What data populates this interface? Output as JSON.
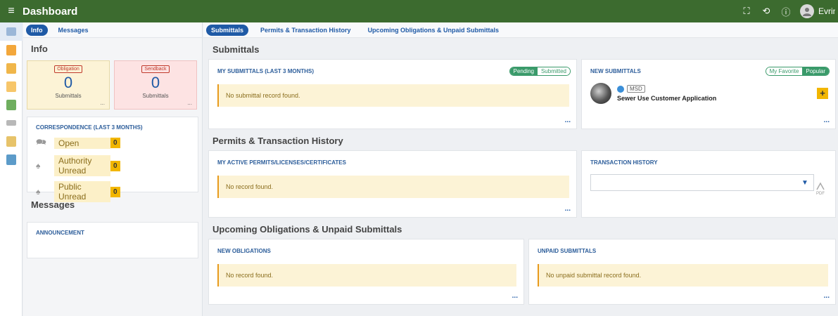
{
  "topbar": {
    "title": "Dashboard",
    "user_name": "Evrin"
  },
  "left": {
    "tabs": [
      "Info",
      "Messages"
    ],
    "info_heading": "Info",
    "cards": [
      {
        "badge": "Obligation",
        "count": "0",
        "label": "Submittals",
        "more": "..."
      },
      {
        "badge": "Sendback",
        "count": "0",
        "label": "Submittals",
        "more": "..."
      }
    ],
    "correspondence": {
      "title": "CORRESPONDENCE (LAST 3 MONTHS)",
      "items": [
        {
          "label": "Open",
          "count": "0"
        },
        {
          "label": "Authority Unread",
          "count": "0"
        },
        {
          "label": "Public Unread",
          "count": "0"
        }
      ]
    },
    "messages_heading": "Messages",
    "announcement_title": "ANNOUNCEMENT"
  },
  "main": {
    "tabs": [
      "Submittals",
      "Permits & Transaction History",
      "Upcoming Obligations & Unpaid Submittals"
    ],
    "submittals": {
      "heading": "Submittals",
      "my": {
        "title": "MY SUBMITTALS (LAST 3 MONTHS)",
        "toggle": [
          "Pending",
          "Submitted"
        ],
        "empty": "No submittal record found.",
        "more": "..."
      },
      "new": {
        "title": "NEW SUBMITTALS",
        "toggle": [
          "My Favorite",
          "Popular"
        ],
        "item_tag": "MSD",
        "item_title": "Sewer Use Customer Application",
        "add": "+",
        "more": "..."
      }
    },
    "permits": {
      "heading": "Permits & Transaction History",
      "active": {
        "title": "MY ACTIVE PERMITS/LICENSES/CERTIFICATES",
        "empty": "No record found.",
        "more": "..."
      },
      "history": {
        "title": "TRANSACTION HISTORY",
        "pdf": "PDF"
      }
    },
    "upcoming": {
      "heading": "Upcoming Obligations & Unpaid Submittals",
      "obligations": {
        "title": "NEW OBLIGATIONS",
        "empty": "No record found.",
        "more": "..."
      },
      "unpaid": {
        "title": "UNPAID SUBMITTALS",
        "empty": "No unpaid submittal record found.",
        "more": "..."
      }
    }
  },
  "colors": {
    "topbar": "#3c6b2f",
    "link": "#1f5aa6",
    "accent_yellow": "#f2b600",
    "toggle_green": "#3a9a6a"
  }
}
